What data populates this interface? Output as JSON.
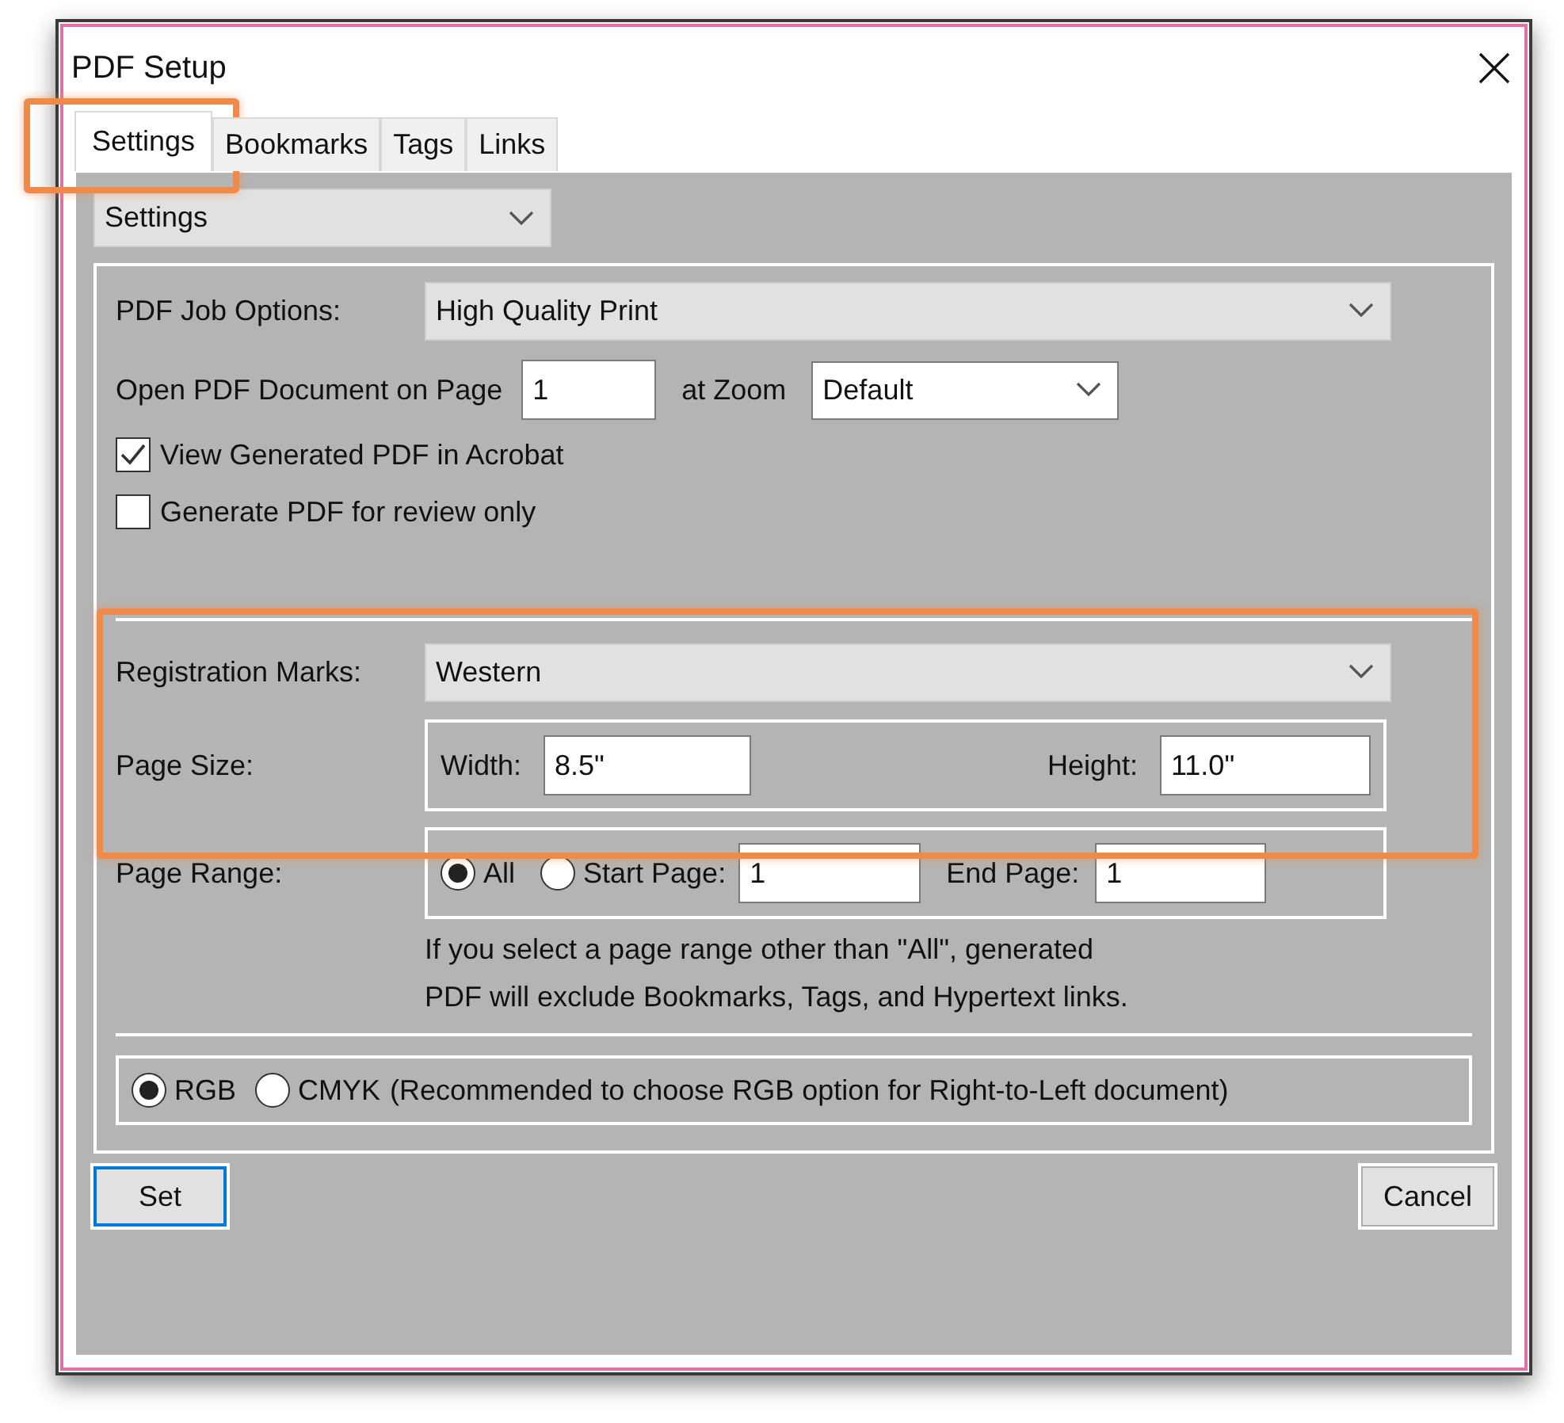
{
  "window": {
    "title": "PDF Setup"
  },
  "tabs": [
    {
      "label": "Settings",
      "selected": true
    },
    {
      "label": "Bookmarks",
      "selected": false
    },
    {
      "label": "Tags",
      "selected": false
    },
    {
      "label": "Links",
      "selected": false
    }
  ],
  "section_select": {
    "value": "Settings"
  },
  "job_options": {
    "label": "PDF Job Options:",
    "value": "High Quality Print"
  },
  "open_page": {
    "label": "Open PDF Document on Page",
    "value": "1",
    "zoom_label": "at Zoom",
    "zoom_value": "Default"
  },
  "checkboxes": [
    {
      "label": "View Generated PDF in Acrobat",
      "checked": true
    },
    {
      "label": "Generate PDF for review only",
      "checked": false
    }
  ],
  "registration": {
    "label": "Registration Marks:",
    "value": "Western"
  },
  "page_size": {
    "label": "Page Size:",
    "width_label": "Width:",
    "width": "8.5\"",
    "height_label": "Height:",
    "height": "11.0\""
  },
  "page_range": {
    "label": "Page Range:",
    "options": [
      {
        "label": "All",
        "selected": true
      },
      {
        "label": "Start Page:",
        "selected": false
      }
    ],
    "start": "1",
    "end_label": "End Page:",
    "end": "1",
    "note_lines": [
      "If you select a page range other than \"All\",  generated",
      "PDF will exclude Bookmarks, Tags, and Hypertext links."
    ]
  },
  "color_modes": [
    {
      "label": "RGB",
      "selected": true
    },
    {
      "label": "CMYK",
      "selected": false
    }
  ],
  "color_note": "(Recommended to choose RGB option for Right-to-Left document)",
  "buttons": [
    {
      "label": "Set",
      "default": true
    },
    {
      "label": "Cancel",
      "default": false
    }
  ]
}
